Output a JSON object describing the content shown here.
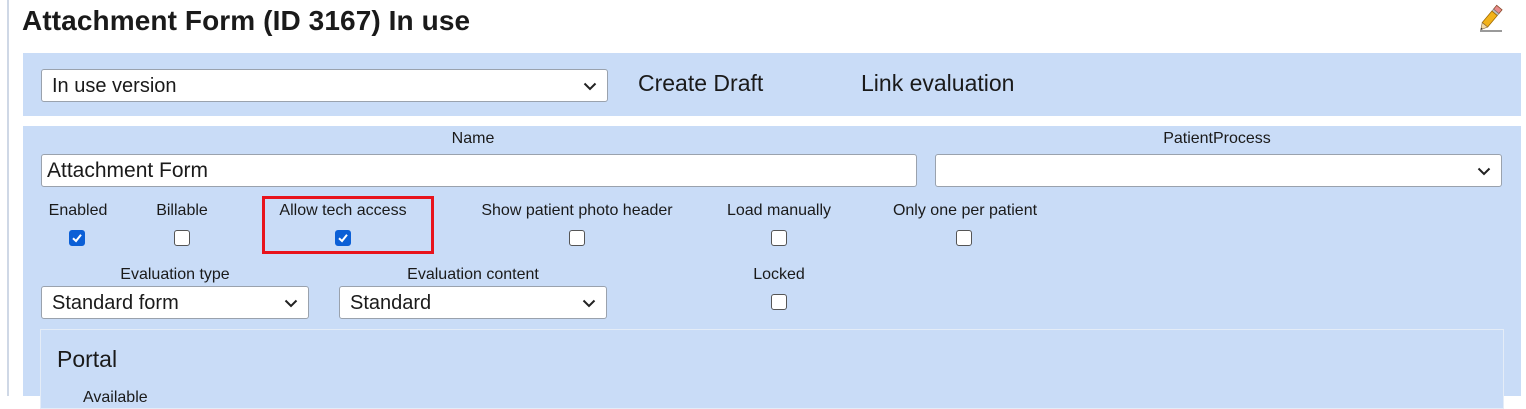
{
  "page": {
    "title": "Attachment Form (ID 3167) In use",
    "edit_icon": "pencil-icon"
  },
  "version_bar": {
    "version_select": "In use version",
    "create_draft": "Create Draft",
    "link_evaluation": "Link evaluation"
  },
  "form": {
    "name_label": "Name",
    "name_value": "Attachment Form",
    "patient_process_label": "PatientProcess",
    "patient_process_value": "",
    "checkboxes": [
      {
        "label": "Enabled",
        "checked": true
      },
      {
        "label": "Billable",
        "checked": false
      },
      {
        "label": "Allow tech access",
        "checked": true
      },
      {
        "label": "Show patient photo header",
        "checked": false
      },
      {
        "label": "Load manually",
        "checked": false
      },
      {
        "label": "Only one per patient",
        "checked": false
      }
    ],
    "evaluation_type_label": "Evaluation type",
    "evaluation_type_value": "Standard form",
    "evaluation_content_label": "Evaluation content",
    "evaluation_content_value": "Standard",
    "locked_label": "Locked",
    "locked_checked": false
  },
  "portal": {
    "title": "Portal",
    "available_label": "Available"
  },
  "colors": {
    "panel_bg": "#c9dcf7",
    "checkbox_accent": "#0b5fd6",
    "highlight": "#e8131c"
  }
}
